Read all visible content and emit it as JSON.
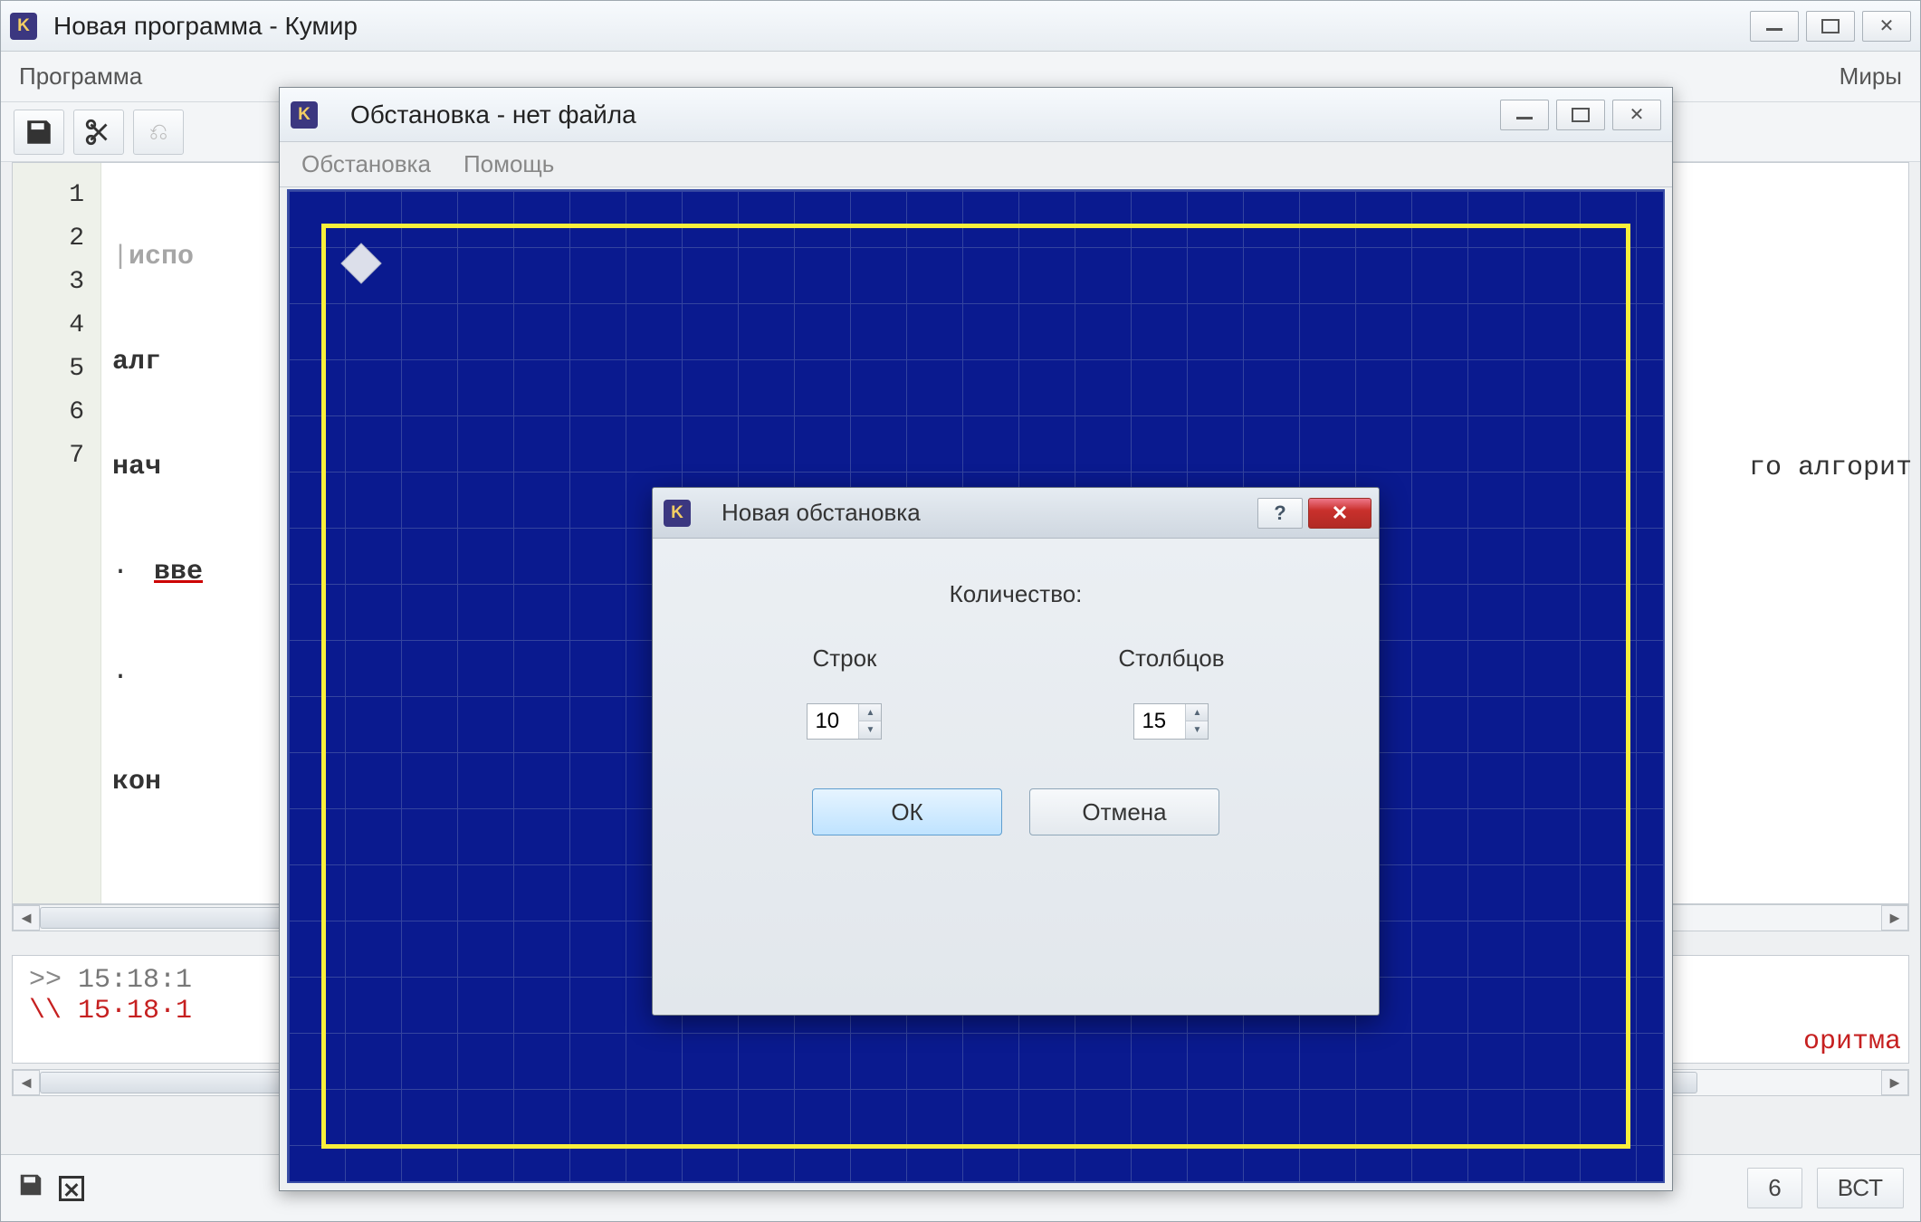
{
  "main_window": {
    "title": "Новая программа - Кумир",
    "menu": {
      "program": "Программа",
      "worlds": "Миры"
    }
  },
  "editor": {
    "line_numbers": [
      "1",
      "2",
      "3",
      "4",
      "5",
      "6",
      "7"
    ],
    "lines": {
      "l1": "испо",
      "l2": "алг",
      "l3": "нач",
      "l4_dot": "·",
      "l4": "вве",
      "l5_dot": "·",
      "l6": "кон"
    },
    "right_hint": "го алгорит"
  },
  "console": {
    "line1_prompt": ">> ",
    "line1_text": "15:18:1",
    "line2_prompt": "\\\\  ",
    "line2_text": "15·18·1",
    "right_text": "оритма"
  },
  "statusbar": {
    "num": "6",
    "mode": "ВСТ"
  },
  "child_window": {
    "title": "Обстановка - нет файла",
    "menu": {
      "env": "Обстановка",
      "help": "Помощь"
    }
  },
  "dialog": {
    "title": "Новая обстановка",
    "count_label": "Количество:",
    "rows_label": "Строк",
    "cols_label": "Столбцов",
    "rows_value": "10",
    "cols_value": "15",
    "ok": "ОК",
    "cancel": "Отмена"
  },
  "icons": {
    "app": "K"
  }
}
